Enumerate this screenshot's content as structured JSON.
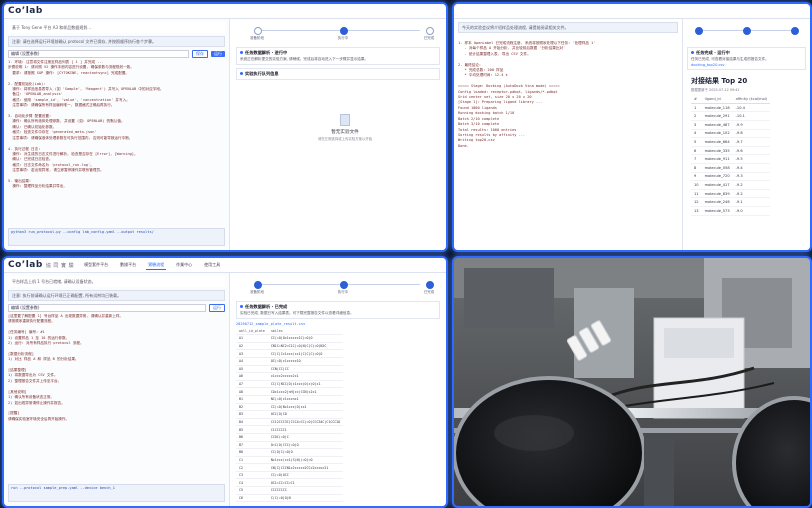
{
  "app": {
    "logo": "Co’lab",
    "logo_sub": "協 同 實 驗",
    "nav_tabs": [
      "模型套件平台",
      "數據平台",
      "實驗流程",
      "作業中心",
      "使用工具"
    ],
    "active_tab_index": 2
  },
  "panel1": {
    "hint_top": "基于 Tony Gene 平台 A3 和样品数据规划...",
    "hint_box": "注意: 请在选择运行环境前确认 protocol 文件已保存, 并按照顺序执行各个步骤。",
    "select_label": "编辑 (设置参数)",
    "buttons": [
      "保存",
      "运行"
    ],
    "code_lines": [
      "1. 环境: 注意将文件注册至样品列表 [ 1 ] 并完成 ...",
      "步骤说明 1: 请对照 V2 操作手册内容进行设置, 确保参数与流程规划一致。",
      "  要求: 请按照 SOP 操作: [CYTOKINE, reactantsync] 完成配置。",
      "",
      "2. 配置初始化(Lab):",
      "  操作: 将样品信息表导入 (如 'Sample', 'Reagent') 并写入 OPENLAB 中的对应字段。",
      "  备注: 'OPENLAB_analysis'",
      "  格式: 使用 'sample_id', 'value', 'concentration' 并写入。",
      "  注意事项: 请确保所有样品编码唯一, 数据格式正确后再执行。",
      "",
      "3. 自动化步骤 配置设置:",
      "  操作: 确认所有液体处理参数, 并设置 (如: OPENLAB) 的默认值。",
      "  确认: 已确认初始化参数。",
      "  格式: 检查文件中存在 'generated_meta.json'",
      "  注意事项: 请确保液体处理参数在可执行范围内, 否则可能导致运行中断。",
      "",
      "4. 执行过程 日志:",
      "  操作: 对生成的日志文件进行解析, 检查是否存在 [Error], [Warning]。",
      "  确认: 已完成日志检查。",
      "  格式: 日志文件命名为 'protocol_run.log'。",
      "  注意事项: 若出现异常, 请立即暂停操作并联系管理员。",
      "",
      "5. 输出结果:",
      "  操作: 整理样品分析结果并导出。"
    ],
    "bottom_cmd": "python3 run_protocol.py --config lab_config.yaml --output results/",
    "stepper": [
      "准备阶段",
      "执行中",
      "已完成"
    ],
    "active_step": 1,
    "card1_title": "任务数据解析 · 进行中",
    "card1_text": "系统正在解析提交的实验方案, 请稍候。完成后将自动进入下一步骤并显示结果。",
    "card2_title": "实验执行队列信息",
    "empty_title": "暂无实验文件",
    "empty_sub": "请在左侧选择或上传实验方案以开始"
  },
  "panel2": {
    "notice": "今天的实验会议将介绍样品处理流程, 请提前阅读相关文件。",
    "code_lines": [
      "1. 样本 OpenLabel 已完成流程注册, 系统将按顺序处理以下任务: '处理样品 1'",
      "   - 对每个样品 A 开始分析, 并比较前后数据 '分析结果比对'",
      "   - 统计结果整理入表, 导出 CSV 文件。",
      "",
      "2. 最终结论:",
      "   * 完成总数: 200 样品",
      "   * 平均处理时间: 12.4 s",
      "",
      "===== Stage: Docking (AutoDock Vina mode) =====",
      "Config loaded: receptor.pdbqt, ligands/*.pdbqt",
      "Grid center set, size 20 x 20 x 20",
      "[Stage 1]: Preparing ligand library ...",
      "Found 1000 ligands",
      "Running docking batch 1/10",
      "Batch 2/10 complete",
      "Batch 3/10 complete",
      "Total results: 1000 entries",
      "Sorting results by affinity ...",
      "Writing top20.csv",
      "Done."
    ],
    "right_card_title": "任务完成 · 运行中",
    "right_card_text": "任务已完成, 可查看对接结果与生成的报告文件。",
    "right_file": "docking_top20.csv",
    "result_title": "对接结果 Top 20",
    "result_sub": "数据更新于 2025-07-12 09:41",
    "columns": [
      "#",
      "ligand_id",
      "affinity (kcal/mol)"
    ],
    "rows": [
      [
        "1",
        "molecule_118",
        "-10.4"
      ],
      [
        "2",
        "molecule_291",
        "-10.1"
      ],
      [
        "3",
        "molecule_487",
        "-9.9"
      ],
      [
        "4",
        "molecule_102",
        "-9.8"
      ],
      [
        "5",
        "molecule_664",
        "-9.7"
      ],
      [
        "6",
        "molecule_335",
        "-9.6"
      ],
      [
        "7",
        "molecule_911",
        "-9.5"
      ],
      [
        "8",
        "molecule_058",
        "-9.4"
      ],
      [
        "9",
        "molecule_720",
        "-9.3"
      ],
      [
        "10",
        "molecule_417",
        "-9.2"
      ],
      [
        "11",
        "molecule_839",
        "-9.2"
      ],
      [
        "12",
        "molecule_246",
        "-9.1"
      ],
      [
        "13",
        "molecule_573",
        "-9.0"
      ]
    ]
  },
  "panel3": {
    "hint_top": "平台样品上机 1 号台已就绪, 请确认设备状态。",
    "hint_box": "注意: 执行前请确认运行环境已正确配置, 所有试剂均已装载。",
    "select_label": "编辑 (设置参数)",
    "buttons": [
      "运行"
    ],
    "code_lines": [
      "[这里要了解配置 1] 号台样品 A 出现数据异常, 请确认并重新上样。",
      "请按顺序重新执行配置流程。",
      "",
      "[任务编号] 编号: #1",
      "1) 设置样品 1 至 10 的运行参数。",
      "2) 运行: 对所有样品执行 protocol 流程。",
      "",
      "[数据分析流程]",
      "1) 对比 样品 A 和 样品 B 的分析结果。",
      "",
      "[结果整理]",
      "1) 将数据导出为 CSV 文件。",
      "2) 整理报告文件并上传至平台。",
      "",
      "[其他说明]",
      "1) 确认所有设备状态正常。",
      "2) 如出现异常请停止操作并报告。",
      "",
      "[提醒]",
      "请确保实验室环境安全后再开始操作。"
    ],
    "bottom_cmd": "run --protocol sample_prep.yaml --device bench_1",
    "stepper": [
      "准备阶段",
      "执行中",
      "已完成"
    ],
    "active_step": 2,
    "card_title": "任务数据解析 · 已完成",
    "card_text": "实验已完成, 数据已写入结果表。可下载完整报告文件以查看详细信息。",
    "file_label": "20250712_sample_plate_result.csv",
    "columns": [
      "well_id_plate",
      "smiles"
    ],
    "rows": [
      [
        "A1",
        "CC(=O)Oc1ccccc1C(=O)O"
      ],
      [
        "A2",
        "CN1C=NC2=C1C(=O)N(C)C(=O)N2C"
      ],
      [
        "A3",
        "CC(C)Cc1ccc(cc1)C(C)C(=O)O"
      ],
      [
        "A4",
        "OC(=O)c1ccccc1O"
      ],
      [
        "A5",
        "CCN(CC)CC"
      ],
      [
        "A6",
        "c1ccc2ccccc2c1"
      ],
      [
        "A7",
        "CC(C)NCC(O)c1ccc(O)c(O)c1"
      ],
      [
        "A8",
        "COc1ccc2[nH]cc(CCN)c2c1"
      ],
      [
        "B1",
        "NC(=O)c1cccnc1"
      ],
      [
        "B2",
        "CC(=O)Nc1ccc(O)cc1"
      ],
      [
        "B3",
        "OCC(O)CO"
      ],
      [
        "B4",
        "CC12CCC3C(CCC4=CC(=O)CCC34C)C1CCC2O"
      ],
      [
        "B5",
        "C1CCCCC1"
      ],
      [
        "B6",
        "CCOC(=O)C"
      ],
      [
        "B7",
        "O=C(O)CCC(=O)O"
      ],
      [
        "B8",
        "CC(O)C(=O)O"
      ],
      [
        "C1",
        "Nc1ccc(cc1)S(N)(=O)=O"
      ],
      [
        "C2",
        "CN(C)CCCN1c2ccccc2CCc2ccccc21"
      ],
      [
        "C3",
        "CC(=O)OCC"
      ],
      [
        "C4",
        "OC1=CC=CC=C1"
      ],
      [
        "C5",
        "CCCCCCCC"
      ],
      [
        "C6",
        "C(C(=O)O)N"
      ]
    ]
  },
  "panel4": {
    "scene": "lab-robot-camera-feed"
  },
  "colors": {
    "frame_border": "#2f6bff",
    "background": "#0b1630",
    "accent": "#2d6bff"
  }
}
